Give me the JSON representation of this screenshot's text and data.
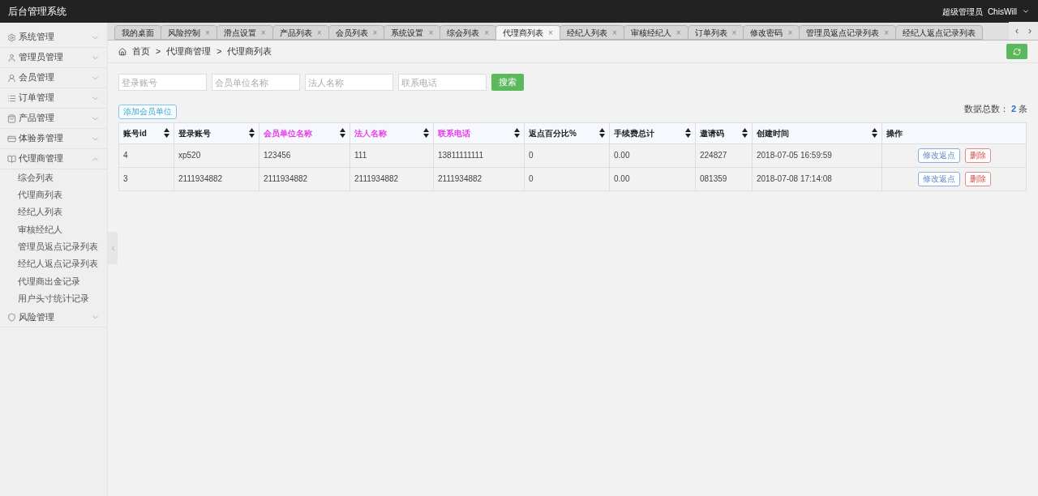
{
  "header": {
    "title": "后台管理系统",
    "role": "超级管理员",
    "user": "ChisWill"
  },
  "sidebar": {
    "groups": [
      {
        "label": "系统管理",
        "expanded": false
      },
      {
        "label": "管理员管理",
        "expanded": false
      },
      {
        "label": "会员管理",
        "expanded": false
      },
      {
        "label": "订单管理",
        "expanded": false
      },
      {
        "label": "产品管理",
        "expanded": false
      },
      {
        "label": "体验券管理",
        "expanded": false
      },
      {
        "label": "代理商管理",
        "expanded": true,
        "children": [
          "综会列表",
          "代理商列表",
          "经纪人列表",
          "审核经纪人",
          "管理员返点记录列表",
          "经纪人返点记录列表",
          "代理商出金记录",
          "用户头寸统计记录"
        ]
      },
      {
        "label": "风险管理",
        "expanded": false
      }
    ]
  },
  "tabs": [
    {
      "label": "我的桌面",
      "selected": false
    },
    {
      "label": "风险控制",
      "close": "×",
      "selected": false
    },
    {
      "label": "滑点设置",
      "close": "×",
      "selected": false
    },
    {
      "label": "产品列表",
      "close": "×",
      "selected": false
    },
    {
      "label": "会员列表",
      "close": "×",
      "selected": false
    },
    {
      "label": "系统设置",
      "close": "×",
      "selected": false
    },
    {
      "label": "综会列表",
      "close": "×",
      "selected": false
    },
    {
      "label": "代理商列表",
      "close": "×",
      "selected": true
    },
    {
      "label": "经纪人列表",
      "close": "×",
      "selected": false
    },
    {
      "label": "审核经纪人",
      "close": "×",
      "selected": false
    },
    {
      "label": "订单列表",
      "close": "×",
      "selected": false
    },
    {
      "label": "修改密码",
      "close": "×",
      "selected": false
    },
    {
      "label": "管理员返点记录列表",
      "close": "×",
      "selected": false
    },
    {
      "label": "经纪人返点记录列表",
      "selected": false
    }
  ],
  "tab_scroll": [
    "‹",
    "›"
  ],
  "breadcrumb": [
    "首页",
    ">",
    "代理商管理",
    ">",
    "代理商列表"
  ],
  "filters": {
    "fields": [
      {
        "placeholder": "登录账号"
      },
      {
        "placeholder": "会员单位名称"
      },
      {
        "placeholder": "法人名称"
      },
      {
        "placeholder": "联系电话"
      }
    ],
    "search_button": "搜索"
  },
  "add_button": "添加会员单位",
  "total": {
    "label": "数据总数：",
    "count": "2",
    "unit": "条"
  },
  "table": {
    "columns": [
      {
        "label": "账号id",
        "sortable": true,
        "highlighted": false
      },
      {
        "label": "登录账号",
        "sortable": true,
        "highlighted": false
      },
      {
        "label": "会员单位名称",
        "sortable": true,
        "highlighted": true
      },
      {
        "label": "法人名称",
        "sortable": true,
        "highlighted": true
      },
      {
        "label": "联系电话",
        "sortable": true,
        "highlighted": true
      },
      {
        "label": "返点百分比%",
        "sortable": true,
        "highlighted": false
      },
      {
        "label": "手续费总计",
        "sortable": true,
        "highlighted": false
      },
      {
        "label": "邀请码",
        "sortable": true,
        "highlighted": false
      },
      {
        "label": "创建时间",
        "sortable": true,
        "highlighted": false
      },
      {
        "label": "操作",
        "sortable": false,
        "highlighted": false
      }
    ],
    "rows": [
      {
        "cells": [
          "4",
          "xp520",
          "123456",
          "111",
          "13811111111",
          "0",
          "0.00",
          "224827",
          "2018-07-05 16:59:59"
        ],
        "actions": [
          "修改返点",
          "删除"
        ]
      },
      {
        "cells": [
          "3",
          "2111934882",
          "2111934882",
          "2111934882",
          "2111934882",
          "0",
          "0.00",
          "081359",
          "2018-07-08 17:14:08"
        ],
        "actions": [
          "修改返点",
          "删除"
        ]
      }
    ]
  }
}
